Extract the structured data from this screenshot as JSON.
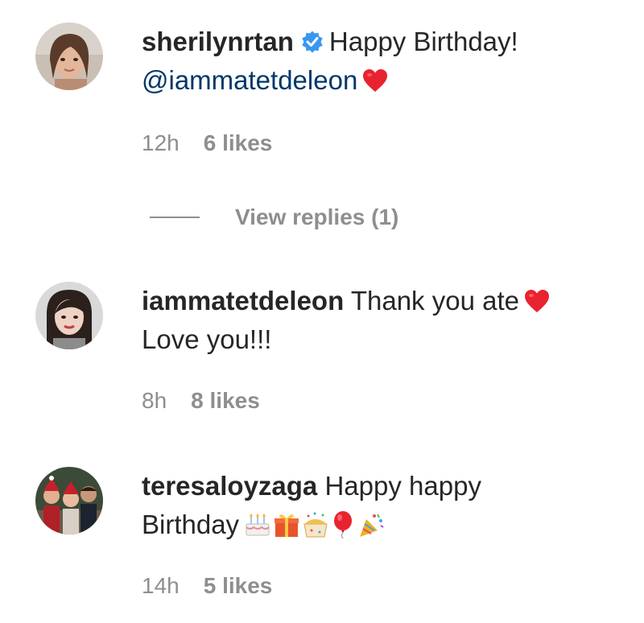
{
  "comments": [
    {
      "avatar_icon": "user-avatar-photo",
      "username": "sherilynrtan",
      "verified": true,
      "verified_icon": "verified-badge-icon",
      "text": "Happy Birthday!",
      "mention": "@iammatetdeleon",
      "emoji": "red-heart-icon",
      "time": "12h",
      "likes": "6 likes",
      "view_replies": "View replies (1)"
    },
    {
      "avatar_icon": "user-avatar-photo",
      "username": "iammatetdeleon",
      "text": "Thank you ate",
      "text_line2": "Love you!!!",
      "emoji": "red-heart-icon",
      "time": "8h",
      "likes": "8 likes"
    },
    {
      "avatar_icon": "user-avatar-photo",
      "username": "teresaloyzaga",
      "text": "Happy happy",
      "text_line2": "Birthday",
      "emojis": [
        "birthday-cake-icon",
        "gift-icon",
        "confetti-ball-icon",
        "balloon-icon",
        "party-popper-icon"
      ],
      "time": "14h",
      "likes": "5 likes"
    }
  ],
  "colors": {
    "text": "#262626",
    "muted": "#8e8e8e",
    "mention": "#00376b",
    "verified": "#3897f0",
    "heart": "#ed4956"
  }
}
